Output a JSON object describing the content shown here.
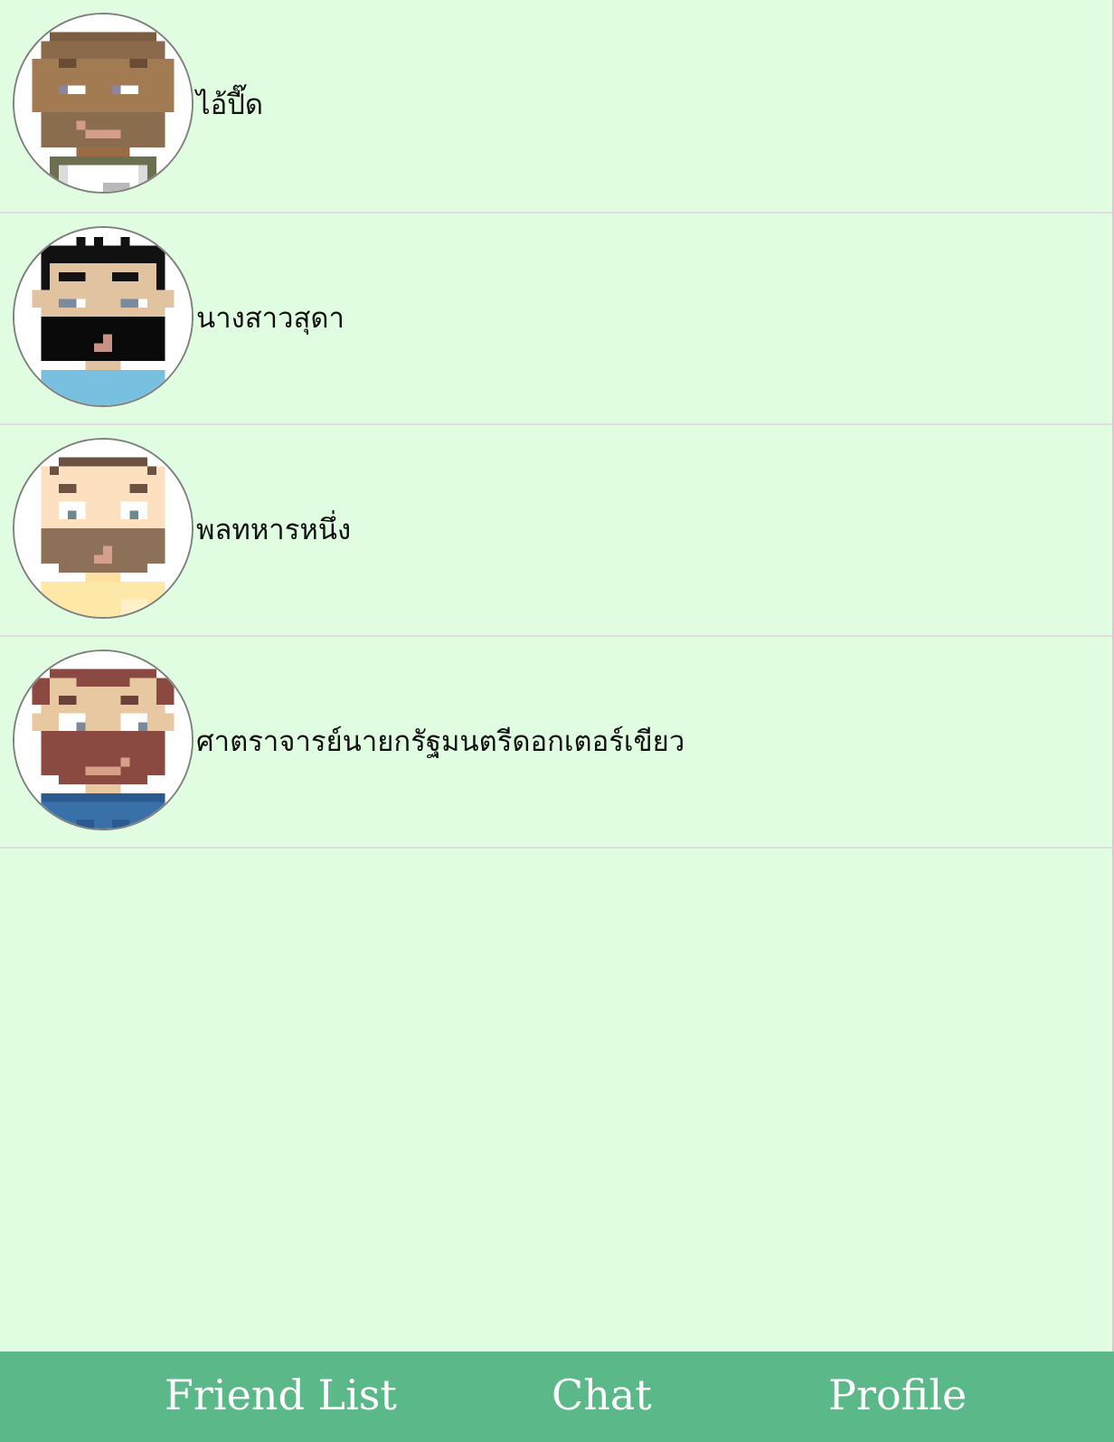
{
  "friends": [
    {
      "name": "ไอ้ปี๊ด",
      "avatar": "pixel-avatar-brown-skin-beard"
    },
    {
      "name": "นางสาวสุดา",
      "avatar": "pixel-avatar-black-hair-beard"
    },
    {
      "name": "พลทหารหนึ่ง",
      "avatar": "pixel-avatar-brown-hair-beard"
    },
    {
      "name": "ศาตราจารย์นายกรัฐมนตรีดอกเตอร์เขียว",
      "avatar": "pixel-avatar-red-hair-beard"
    }
  ],
  "nav": {
    "friend_list_label": "Friend List",
    "chat_label": "Chat",
    "profile_label": "Profile"
  },
  "colors": {
    "background": "#e1fde1",
    "nav_background": "#5bb888",
    "nav_text": "#ffffff"
  }
}
